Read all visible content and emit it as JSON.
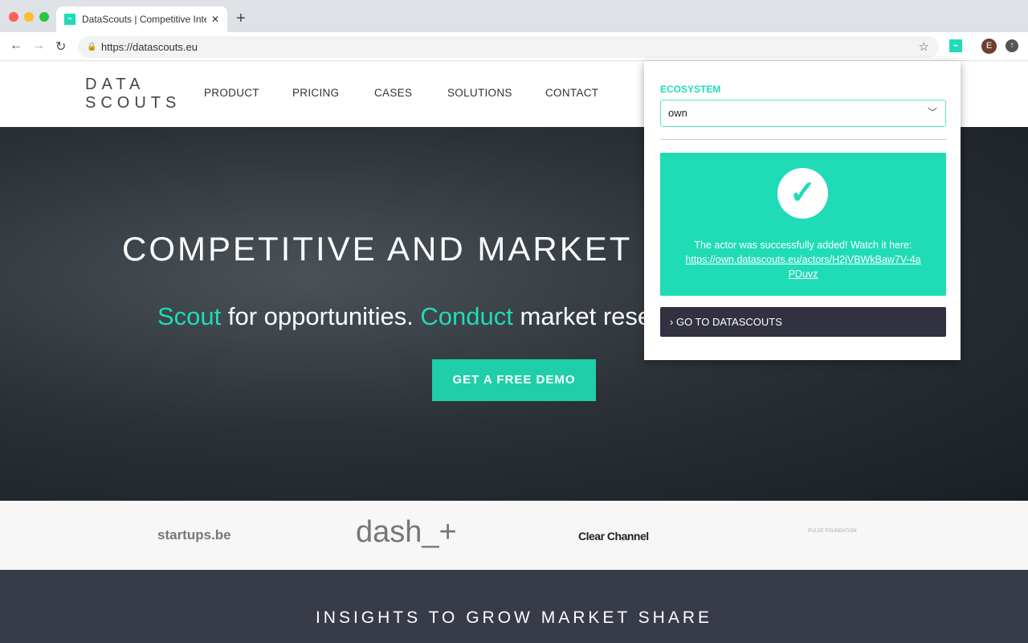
{
  "browser": {
    "tab_title": "DataScouts | Competitive Intelligence",
    "url": "https://datascouts.eu",
    "user_initial": "E"
  },
  "site": {
    "logo_line1": "DATA",
    "logo_line2": "SCOUTS",
    "nav": [
      "PRODUCT",
      "PRICING",
      "CASES",
      "SOLUTIONS",
      "CONTACT"
    ],
    "hero_title": "COMPETITIVE AND MARKET",
    "hero_sub_1": "Scout",
    "hero_sub_2": " for opportunities. ",
    "hero_sub_3": "Conduct",
    "hero_sub_4": " market rese",
    "demo_button": "GET A FREE DEMO",
    "partners": [
      "startups.be",
      "dash_+",
      "Clear Channel",
      "PULSE FOUNDATION"
    ],
    "insights_title": "INSIGHTS TO GROW MARKET SHARE"
  },
  "popup": {
    "ecosystem_label": "ECOSYSTEM",
    "ecosystem_value": "own",
    "success_message": "The actor was successfully added! Watch it here:",
    "actor_link": "https://own.datascouts.eu/actors/H2jVBWkBaw7V-4aPDuvz",
    "goto_button": "GO TO DATASCOUTS"
  },
  "colors": {
    "accent": "#1fdcb7",
    "dark": "#31313f"
  }
}
